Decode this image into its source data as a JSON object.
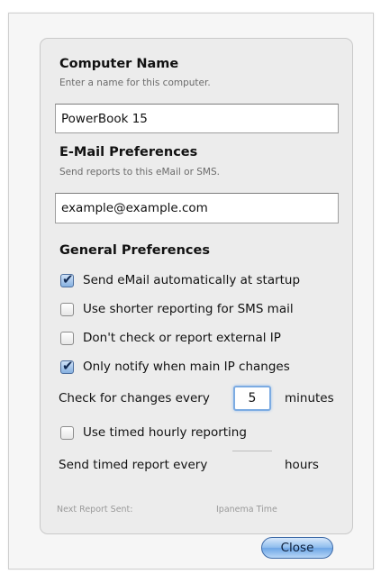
{
  "computer_name": {
    "title": "Computer Name",
    "subtitle": "Enter a name for this computer.",
    "value": "PowerBook 15"
  },
  "email_prefs": {
    "title": "E-Mail Preferences",
    "subtitle": "Send reports to this eMail or SMS.",
    "value": "example@example.com"
  },
  "general_prefs": {
    "title": "General Preferences",
    "options": [
      {
        "label": "Send eMail automatically at startup",
        "checked": true
      },
      {
        "label": "Use shorter reporting for SMS mail",
        "checked": false
      },
      {
        "label": "Don't check or report external IP",
        "checked": false
      },
      {
        "label": "Only notify when main IP changes",
        "checked": true
      }
    ],
    "check_changes_prefix": "Check for changes every",
    "check_changes_value": "5",
    "check_changes_suffix": "minutes",
    "timed_hourly": {
      "label": "Use timed hourly reporting",
      "checked": false
    },
    "timed_report_prefix": "Send timed report every",
    "timed_report_value": "",
    "timed_report_suffix": "hours"
  },
  "footer": {
    "next_report_label": "Next Report Sent:",
    "next_report_value": "Ipanema Time",
    "close_label": "Close"
  }
}
